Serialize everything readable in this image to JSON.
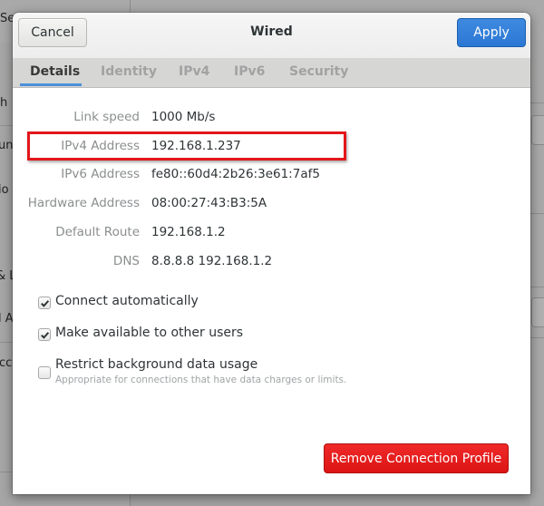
{
  "background_window": {
    "header_fragment": "Se",
    "sidebar_fragments": [
      "h",
      "un",
      "io",
      "& L",
      "l A",
      "cc"
    ]
  },
  "dialog": {
    "title": "Wired",
    "cancel_label": "Cancel",
    "apply_label": "Apply",
    "tabs": [
      {
        "label": "Details",
        "active": true
      },
      {
        "label": "Identity",
        "active": false
      },
      {
        "label": "IPv4",
        "active": false
      },
      {
        "label": "IPv6",
        "active": false
      },
      {
        "label": "Security",
        "active": false
      }
    ],
    "details": [
      {
        "label": "Link speed",
        "value": "1000 Mb/s"
      },
      {
        "label": "IPv4 Address",
        "value": "192.168.1.237",
        "highlighted": true
      },
      {
        "label": "IPv6 Address",
        "value": "fe80::60d4:2b26:3e61:7af5"
      },
      {
        "label": "Hardware Address",
        "value": "08:00:27:43:B3:5A"
      },
      {
        "label": "Default Route",
        "value": "192.168.1.2"
      },
      {
        "label": "DNS",
        "value": "8.8.8.8 192.168.1.2"
      }
    ],
    "options": [
      {
        "label": "Connect automatically",
        "checked": true
      },
      {
        "label": "Make available to other users",
        "checked": true
      },
      {
        "label": "Restrict background data usage",
        "checked": false,
        "description": "Appropriate for connections that have data charges or limits."
      }
    ],
    "remove_label": "Remove Connection Profile"
  },
  "colors": {
    "accent": "#3584e4",
    "destructive": "#e01b24",
    "highlight_box": "#e3171b"
  }
}
